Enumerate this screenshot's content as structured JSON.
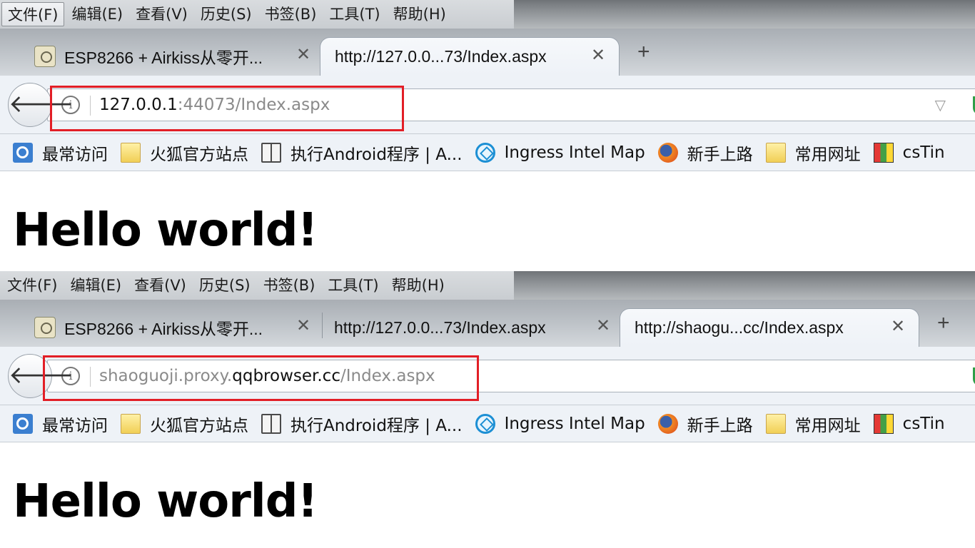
{
  "menu": [
    "文件(F)",
    "编辑(E)",
    "查看(V)",
    "历史(S)",
    "书签(B)",
    "工具(T)",
    "帮助(H)"
  ],
  "bookmarks": [
    {
      "label": "最常访问",
      "icon": "search-icon"
    },
    {
      "label": "火狐官方站点",
      "icon": "folder-icon"
    },
    {
      "label": "执行Android程序 | A...",
      "icon": "book-icon"
    },
    {
      "label": "Ingress Intel Map",
      "icon": "ingress-icon"
    },
    {
      "label": "新手上路",
      "icon": "firefox-icon"
    },
    {
      "label": "常用网址",
      "icon": "folder-icon"
    },
    {
      "label": "csTin",
      "icon": "cstime-icon"
    }
  ],
  "windows": [
    {
      "tabs": [
        {
          "title": "ESP8266 + Airkiss从零开...",
          "selected": false
        },
        {
          "title": "http://127.0.0...73/Index.aspx",
          "selected": true
        }
      ],
      "url": {
        "host": "127.0.0.1",
        "rest": ":44073/Index.aspx"
      },
      "heading": "Hello world!"
    },
    {
      "tabs": [
        {
          "title": "ESP8266 + Airkiss从零开...",
          "selected": false
        },
        {
          "title": "http://127.0.0...73/Index.aspx",
          "selected": false
        },
        {
          "title": "http://shaogu...cc/Index.aspx",
          "selected": true
        }
      ],
      "url": {
        "pre": "shaoguoji.proxy.",
        "host": "qqbrowser.cc",
        "rest": "/Index.aspx"
      },
      "heading": "Hello world!"
    }
  ],
  "colors": {
    "highlight": "#e21e26",
    "selected_tab": "#eef2f7"
  }
}
